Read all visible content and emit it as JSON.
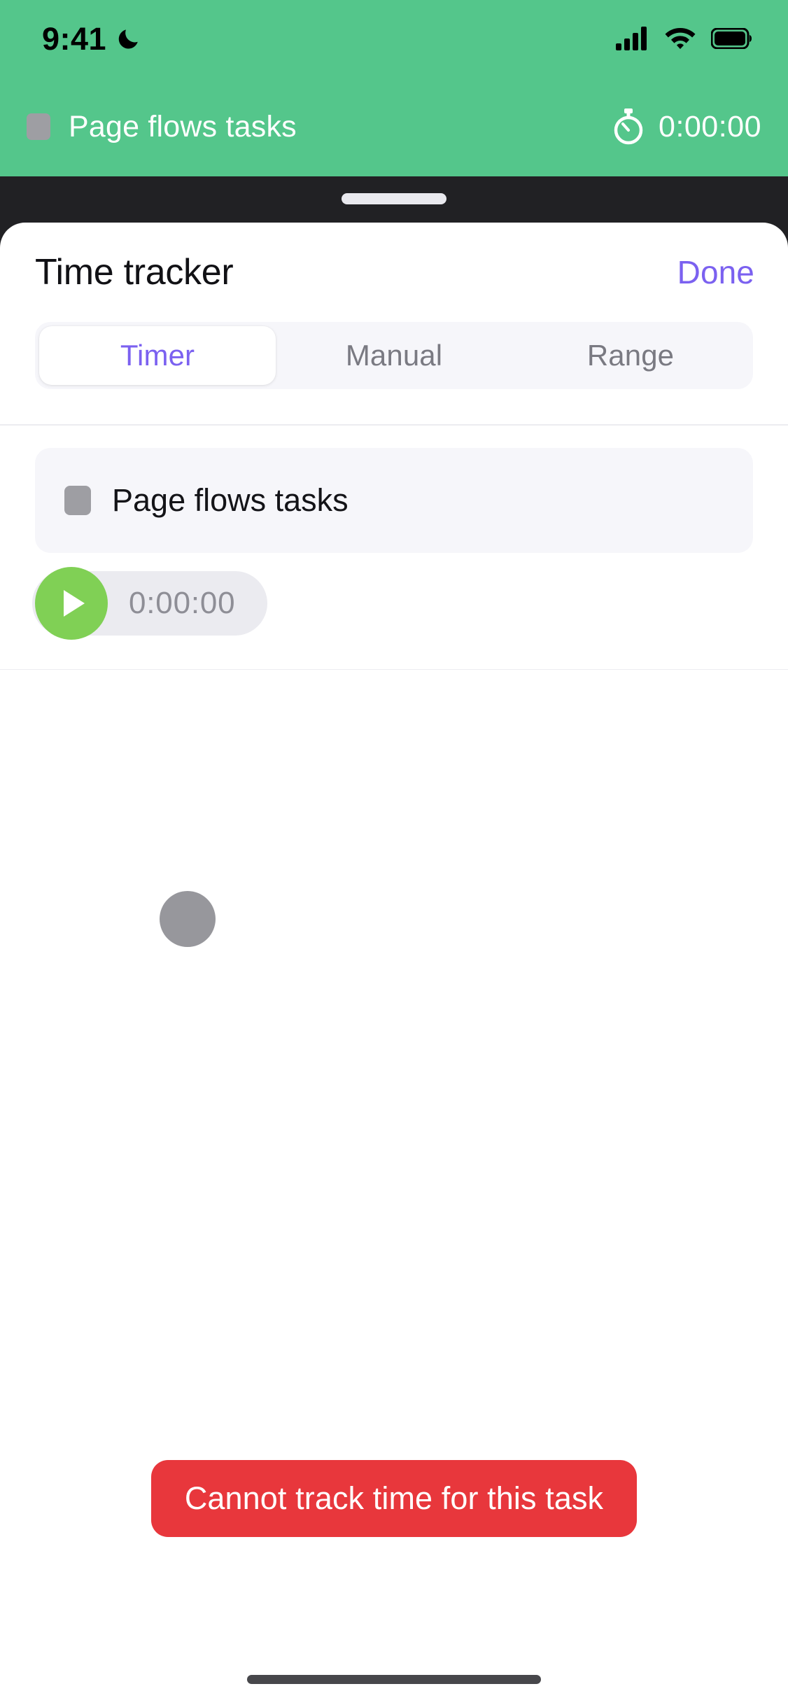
{
  "status_bar": {
    "time": "9:41",
    "dnd_icon": "moon-icon",
    "signal_icon": "cellular-signal-icon",
    "wifi_icon": "wifi-icon",
    "battery_icon": "battery-full-icon"
  },
  "app_header": {
    "task_chip_icon": "task-color-chip",
    "title": "Page flows tasks",
    "stopwatch_icon": "stopwatch-icon",
    "elapsed": "0:00:00",
    "background_color": "#54c68b"
  },
  "backdrop": {
    "grabber_icon": "sheet-grabber",
    "background_color": "#212124"
  },
  "sheet": {
    "title": "Time tracker",
    "done_label": "Done",
    "accent_color": "#7b61f0",
    "tabs": [
      {
        "label": "Timer",
        "active": true
      },
      {
        "label": "Manual",
        "active": false
      },
      {
        "label": "Range",
        "active": false
      }
    ],
    "task_card": {
      "chip_icon": "task-color-chip",
      "title": "Page flows tasks"
    },
    "timer": {
      "play_icon": "play-icon",
      "play_color": "#80d055",
      "value": "0:00:00"
    },
    "placeholder_icon": "gray-circle-placeholder"
  },
  "toast": {
    "message": "Cannot track time for this task",
    "color": "#e8373c"
  },
  "home_indicator": {
    "icon": "home-indicator"
  }
}
